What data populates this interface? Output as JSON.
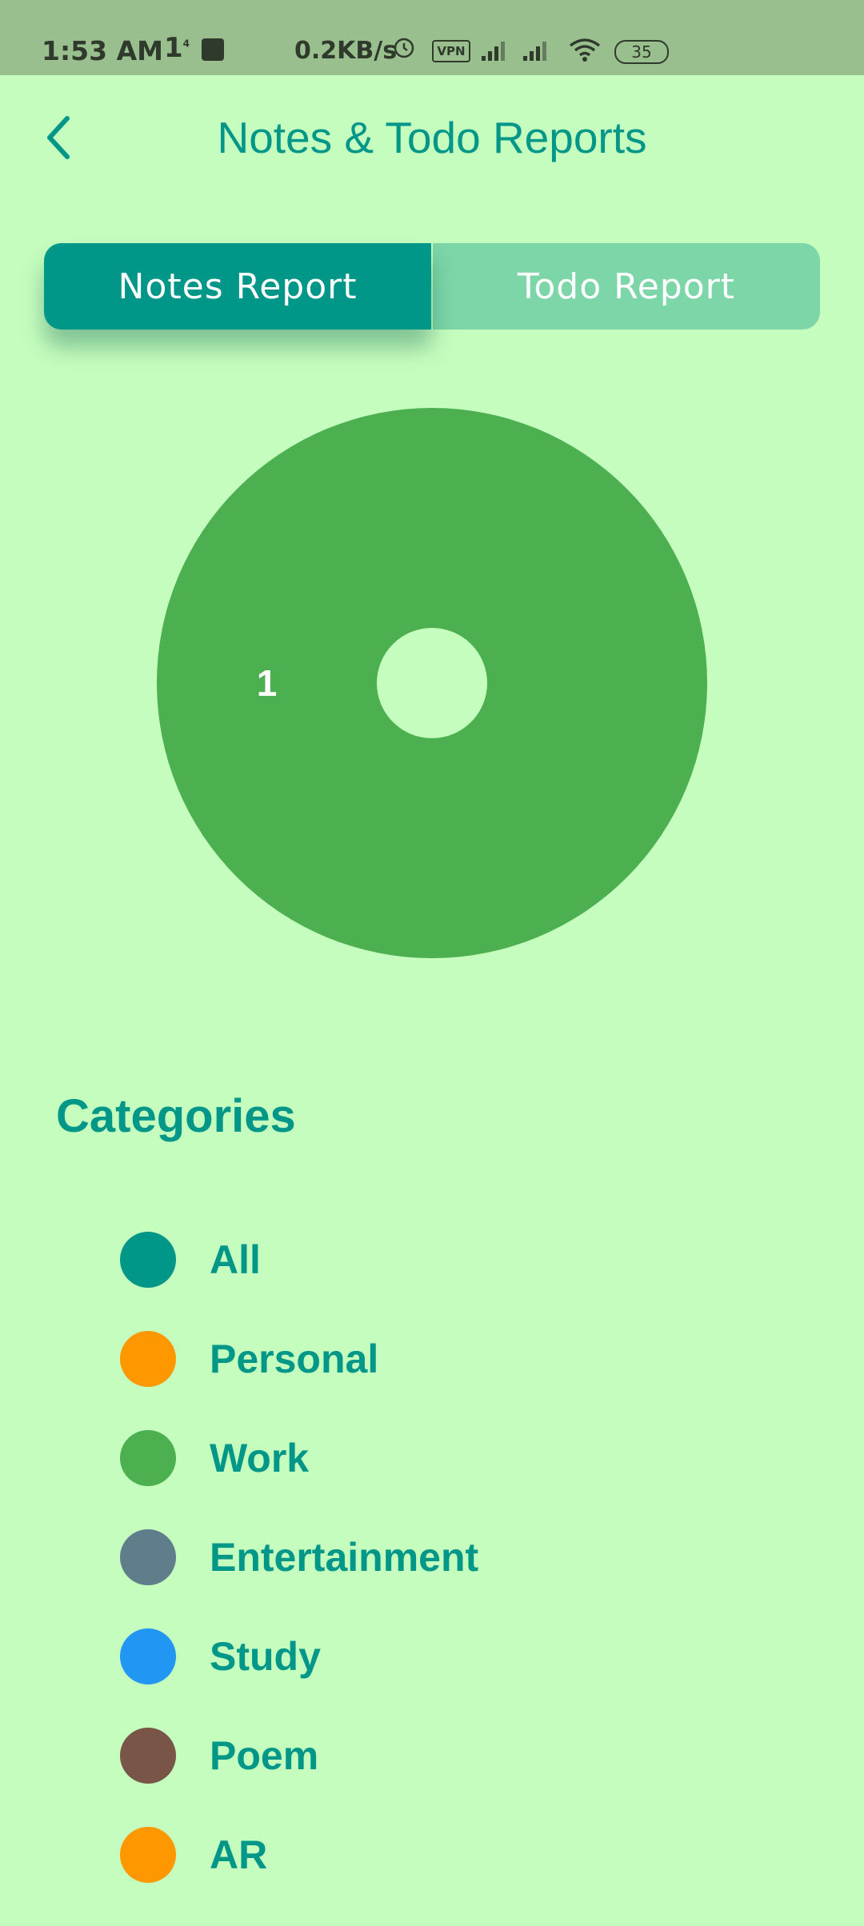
{
  "status_bar": {
    "time": "1:53 AM",
    "indicator": "1",
    "indicator_sup": "4",
    "speed": "0.2KB/s",
    "vpn": "VPN",
    "battery": "35"
  },
  "header": {
    "title": "Notes & Todo Reports"
  },
  "tabs": [
    {
      "label": "Notes Report",
      "active": true
    },
    {
      "label": "Todo Report",
      "active": false
    }
  ],
  "chart_data": {
    "type": "pie",
    "categories": [
      "Work"
    ],
    "values": [
      1
    ],
    "colors": [
      "#4caf50"
    ],
    "data_labels": [
      "1"
    ],
    "hole": true
  },
  "categories": {
    "title": "Categories",
    "items": [
      {
        "label": "All",
        "color": "#009688"
      },
      {
        "label": "Personal",
        "color": "#ff9800"
      },
      {
        "label": "Work",
        "color": "#4caf50"
      },
      {
        "label": "Entertainment",
        "color": "#607d8b"
      },
      {
        "label": "Study",
        "color": "#2196f3"
      },
      {
        "label": "Poem",
        "color": "#795548"
      },
      {
        "label": "AR",
        "color": "#ff9800"
      }
    ]
  }
}
